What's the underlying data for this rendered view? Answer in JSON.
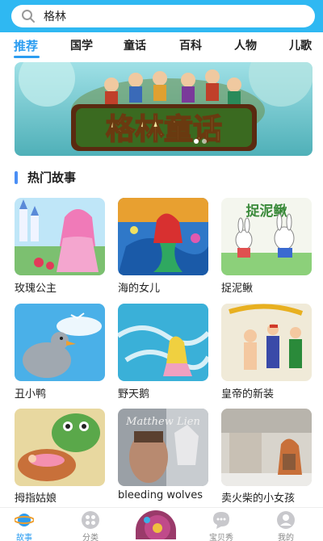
{
  "search": {
    "value": "格林"
  },
  "tabs": [
    {
      "label": "推荐",
      "active": true
    },
    {
      "label": "国学"
    },
    {
      "label": "童话"
    },
    {
      "label": "百科"
    },
    {
      "label": "人物"
    },
    {
      "label": "儿歌"
    }
  ],
  "banner": {
    "title": "格林童话"
  },
  "section": {
    "title": "热门故事"
  },
  "stories": [
    {
      "title": "玫瑰公主"
    },
    {
      "title": "海的女儿"
    },
    {
      "title": "捉泥鳅",
      "cover_text": "捉泥鳅"
    },
    {
      "title": "丑小鸭"
    },
    {
      "title": "野天鹅"
    },
    {
      "title": "皇帝的新装"
    },
    {
      "title": "拇指姑娘"
    },
    {
      "title": "bleeding wolves",
      "cover_text": "Matthew Lien"
    },
    {
      "title": "卖火柴的小女孩"
    }
  ],
  "bottom_nav": [
    {
      "label": "故事",
      "icon": "planet-icon",
      "active": true
    },
    {
      "label": "分类",
      "icon": "grid-icon"
    },
    {
      "label": "宝贝秀",
      "icon": "chat-bubble-icon"
    },
    {
      "label": "我的",
      "icon": "user-icon"
    }
  ],
  "colors": {
    "accent": "#2d9df0",
    "topbar": "#2fb8f2"
  }
}
